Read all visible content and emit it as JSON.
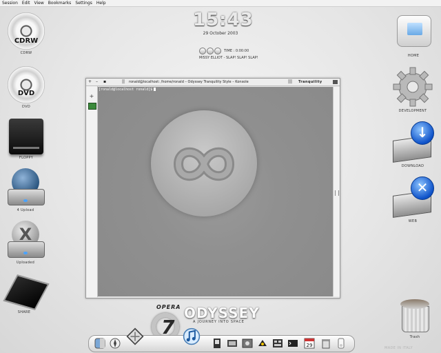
{
  "menubar": [
    "Session",
    "Edit",
    "View",
    "Bookmarks",
    "Settings",
    "Help"
  ],
  "clock": {
    "time": "15:43",
    "date": "29 October 2003"
  },
  "player": {
    "time_label": "TIME : 0:00:00",
    "track": "MISSY ELLIOT - SLAP! SLAP! SLAP!"
  },
  "desktop_left": [
    {
      "label": "CDRW",
      "disc_text": "CDRW"
    },
    {
      "label": "DVD",
      "disc_text": "DVD"
    },
    {
      "label": "FLOPPY"
    },
    {
      "label": "4 Upload"
    },
    {
      "label": "Uploaded"
    },
    {
      "label": "SHARE"
    }
  ],
  "desktop_right": [
    {
      "label": "HOME"
    },
    {
      "label": "DEVELOPMENT"
    },
    {
      "label": "DOWNLOAD"
    },
    {
      "label": "WEB"
    },
    {
      "label": "Trash"
    }
  ],
  "konsole": {
    "title": "ronald@localhost: /home/ronald – Odyssey Tranquility Style – Konsole",
    "brand": "Tranquility",
    "prompt": "[ronald@localhost ronald]$"
  },
  "logo": {
    "opera": "OPERA",
    "title": "ODYSSEY",
    "tagline": "A JOURNEY INTO SPACE"
  },
  "dock_items": [
    "finder-icon",
    "compass-icon",
    "mail-icon",
    "opera-icon",
    "itunes-icon",
    "notes-icon",
    "film-icon",
    "photos-icon",
    "image-icon",
    "gallery-icon",
    "terminal-icon",
    "calendar-icon",
    "trash-small-icon",
    "ipod-icon"
  ],
  "calendar_day": "29",
  "watermark": "MADE IN ITALY"
}
